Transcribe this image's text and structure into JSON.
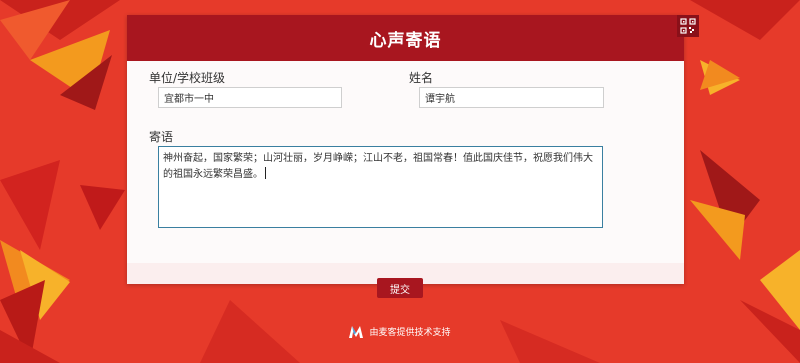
{
  "form": {
    "title": "心声寄语",
    "unit_label": "单位/学校班级",
    "unit_value": "宜都市一中",
    "name_label": "姓名",
    "name_value": "谭宇航",
    "message_label": "寄语",
    "message_value": "神州奋起，国家繁荣；山河壮丽，岁月峥嵘；江山不老，祖国常春！值此国庆佳节，祝愿我们伟大的祖国永远繁荣昌盛。",
    "submit_label": "提交"
  },
  "footer": {
    "powered_by": "由麦客提供技术支持"
  },
  "icons": {
    "qr": "qr-code-icon",
    "logo": "maike-logo-icon"
  },
  "colors": {
    "background": "#e8392a",
    "header": "#a8161f",
    "button": "#a8161f",
    "card": "#fdfafa"
  }
}
